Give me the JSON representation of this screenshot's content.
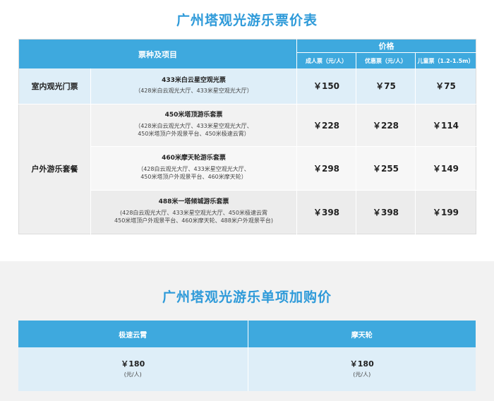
{
  "ticket_section": {
    "title": "广州塔观光游乐票价表",
    "header": {
      "item_col": "票种及项目",
      "price_col": "价格",
      "adult": "成人票（元/人）",
      "discount": "优惠票（元/人）",
      "child": "儿童票（1.2-1.5m）"
    },
    "indoor": {
      "category": "室内观光门票",
      "rows": [
        {
          "name": "433米白云星空观光票",
          "desc": [
            "（428米白云观光大厅、433米星空观光大厅）"
          ],
          "adult": "￥150",
          "discount": "￥75",
          "child": "￥75"
        }
      ]
    },
    "outdoor": {
      "category": "户外游乐套餐",
      "rows": [
        {
          "name": "450米塔顶游乐套票",
          "desc": [
            "（428米白云观光大厅、433米星空观光大厅、",
            "450米塔顶户外观景平台、450米极速云霄）"
          ],
          "adult": "￥228",
          "discount": "￥228",
          "child": "￥114"
        },
        {
          "name": "460米摩天轮游乐套票",
          "desc": [
            "（428白云观光大厅、433米星空观光大厅、",
            "450米塔顶户外观景平台、460米摩天轮）"
          ],
          "adult": "￥298",
          "discount": "￥255",
          "child": "￥149"
        },
        {
          "name": "488米一塔倾城游乐套票",
          "desc": [
            "(428白云观光大厅、433米星空观光大厅、450米极速云霄",
            "450米塔顶户外观景平台、460米摩天轮、488米户外观景平台)"
          ],
          "adult": "￥398",
          "discount": "￥398",
          "child": "￥199"
        }
      ]
    }
  },
  "addon_section": {
    "title": "广州塔观光游乐单项加购价",
    "items": [
      {
        "name": "极速云霄",
        "price": "￥180",
        "unit": "(元/人)"
      },
      {
        "name": "摩天轮",
        "price": "￥180",
        "unit": "(元/人)"
      }
    ]
  }
}
